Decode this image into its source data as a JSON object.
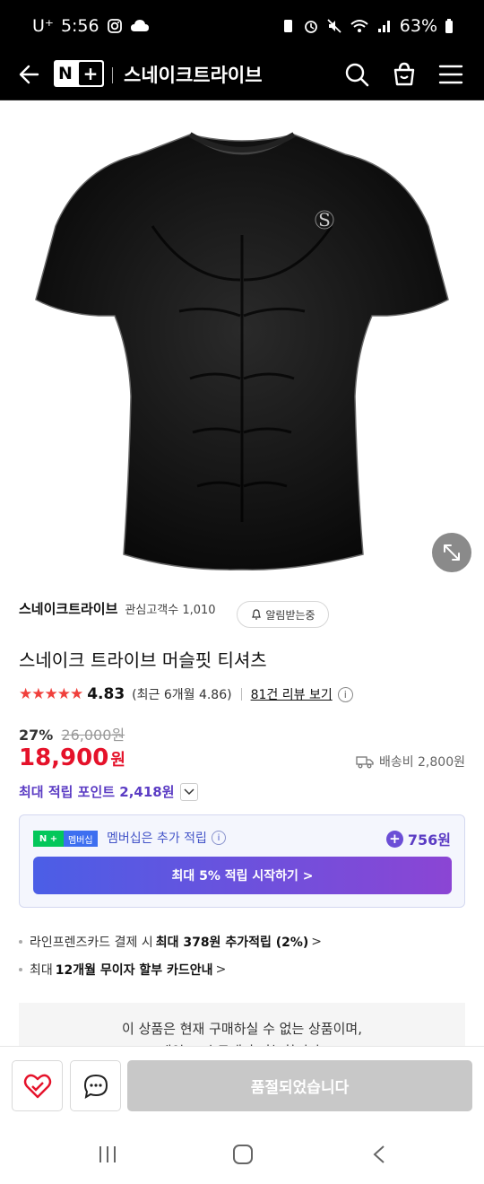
{
  "status": {
    "carrier": "U⁺",
    "time": "5:56",
    "battery": "63%"
  },
  "appbar": {
    "logo_n": "N",
    "logo_plus": "+",
    "store_name": "스네이크트라이브"
  },
  "seller": {
    "name": "스네이크트라이브",
    "fans": "관심고객수 1,010",
    "alert_label": "알림받는중"
  },
  "product": {
    "title": "스네이크 트라이브 머슬핏 티셔츠",
    "stars": "★★★★★",
    "rating": "4.83",
    "recent_rating": "(최근 6개월 4.86)",
    "reviews_link": "81건 리뷰 보기",
    "discount_pct": "27%",
    "original_price": "26,000원",
    "price": "18,900",
    "price_unit": "원",
    "shipping": "배송비 2,800원",
    "max_points": "최대 적립 포인트 2,418원"
  },
  "membership": {
    "badge_n": "N +",
    "badge_label": "멤버십",
    "text": "멤버십은 추가 적립",
    "points": "756원",
    "button": "최대 5% 적립 시작하기 >"
  },
  "benefits": [
    {
      "pre": "라인프렌즈카드 결제 시",
      "bold": "최대 378원 추가적립 (2%)",
      "post": ">"
    },
    {
      "pre": "최대",
      "bold": "12개월 무이자 할부 카드안내",
      "post": ">"
    }
  ],
  "notice": {
    "line1": "이 상품은 현재 구매하실 수 없는 상품이며,",
    "line2": "재입고 시 구매가 가능합니다."
  },
  "bottom": {
    "soldout_button": "품절되었습니다"
  },
  "colors": {
    "price_red": "#e5122a",
    "points_purple": "#5b3cc4",
    "naver_green": "#03c75a"
  }
}
